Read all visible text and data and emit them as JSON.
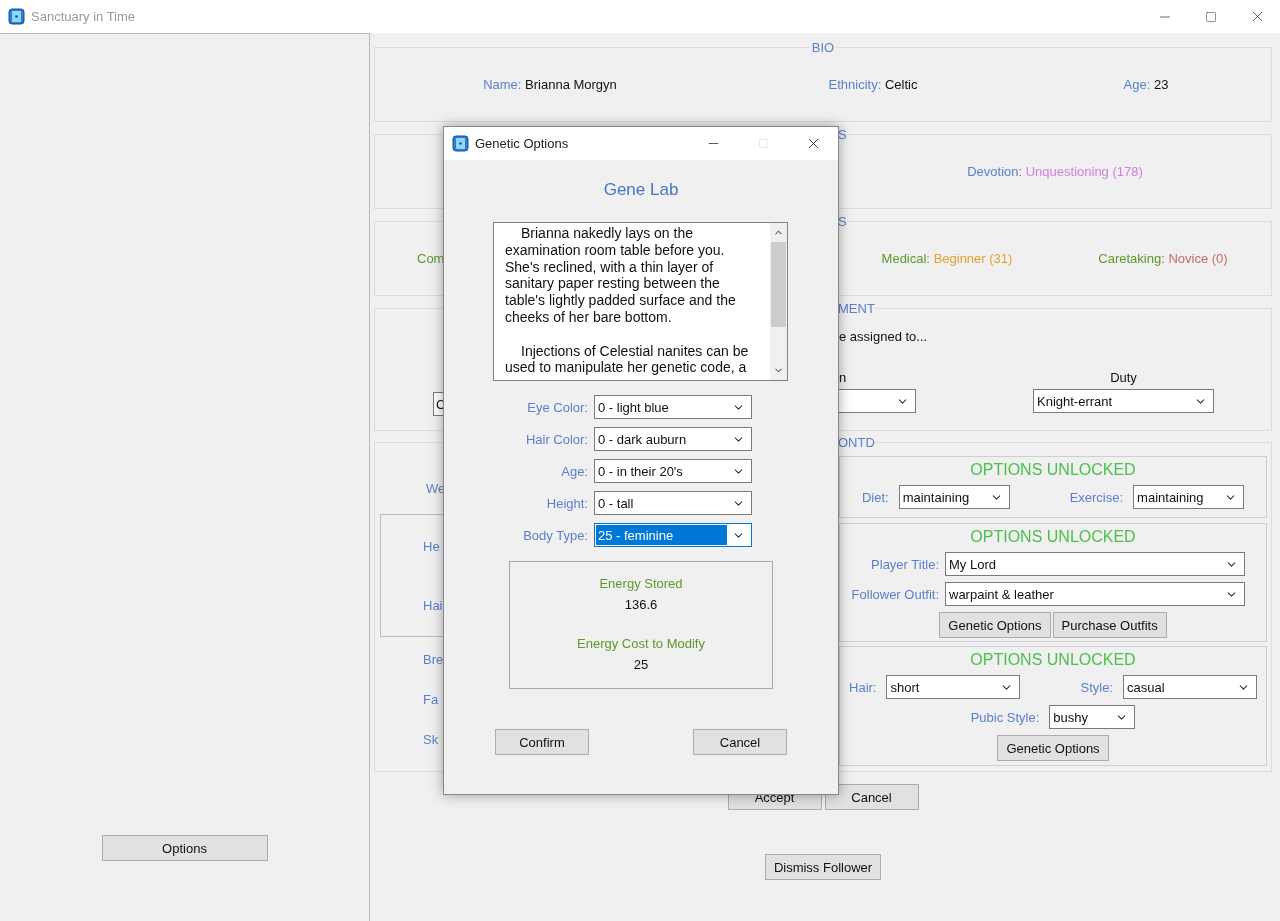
{
  "window": {
    "title": "Sanctuary in Time"
  },
  "sidebar": {
    "buttons": [
      "Options"
    ]
  },
  "bio": {
    "title": "BIO",
    "fields": [
      {
        "label": "Name:",
        "value": "Brianna Morgyn"
      },
      {
        "label": "Ethnicity:",
        "value": "Celtic"
      },
      {
        "label": "Age:",
        "value": "23"
      }
    ]
  },
  "section_2": {
    "title": "S",
    "fields": [
      {
        "label": "Devotion:",
        "value": "Unquestioning (178)",
        "color": "#d27fe0"
      }
    ]
  },
  "section_3": {
    "title": "S",
    "fragment": "Com",
    "fields": [
      {
        "label": "Medical:",
        "value": "Beginner (31)",
        "color": "#e6a030"
      },
      {
        "label": "Caretaking:",
        "value": "Novice (0)",
        "color": "#c86a6a"
      }
    ]
  },
  "assignment": {
    "title": "MENT",
    "prompt": "e assigned to...",
    "left_dropdown": "C",
    "columns": [
      {
        "label": "n"
      },
      {
        "label": "Duty",
        "value": "Knight-errant"
      }
    ]
  },
  "section_5": {
    "title": "ONTD",
    "fragments_top": [
      "We"
    ],
    "inner_fragments": [
      "He",
      "Hai"
    ],
    "fragments_bottom": [
      "Bre",
      "Fa",
      "Sk"
    ],
    "panels": [
      {
        "heading": "OPTIONS UNLOCKED",
        "kind": "inline",
        "rows": [
          [
            {
              "label": "Diet:",
              "value": "maintaining",
              "kind": "medium"
            },
            {
              "label": "Exercise:",
              "value": "maintaining",
              "kind": "medium"
            }
          ]
        ]
      },
      {
        "heading": "OPTIONS UNLOCKED",
        "kind": "form",
        "rows": [
          [
            {
              "label": "Player Title:",
              "value": "My Lord",
              "kind": "wide"
            }
          ],
          [
            {
              "label": "Follower Outfit:",
              "value": "warpaint & leather",
              "kind": "wide"
            }
          ]
        ],
        "buttons": [
          "Genetic Options",
          "Purchase Outfits"
        ]
      },
      {
        "heading": "OPTIONS UNLOCKED",
        "kind": "inline",
        "rows": [
          [
            {
              "label": "Hair:",
              "value": "short",
              "kind": "large"
            },
            {
              "label": "Style:",
              "value": "casual",
              "kind": "large"
            }
          ],
          [
            {
              "label": "Pubic Style:",
              "value": "bushy",
              "kind": "small"
            }
          ]
        ],
        "buttons": [
          "Genetic Options"
        ]
      }
    ]
  },
  "actions": [
    "Accept",
    "Cancel"
  ],
  "dismiss": "Dismiss Follower",
  "dialog": {
    "title": "Genetic Options",
    "heading": "Gene Lab",
    "description": [
      "Brianna nakedly lays on the examination room table before you. She's reclined, with a thin layer of sanitary paper resting between the table's lightly padded surface and the cheeks of her bare bottom.",
      "Injections of Celestial nanites can be used to manipulate her genetic code, a"
    ],
    "fields": [
      {
        "label": "Eye Color:",
        "value": "0 - light blue",
        "selected": false
      },
      {
        "label": "Hair Color:",
        "value": "0 - dark auburn",
        "selected": false
      },
      {
        "label": "Age:",
        "value": "0 - in their 20's",
        "selected": false
      },
      {
        "label": "Height:",
        "value": "0 - tall",
        "selected": false
      },
      {
        "label": "Body Type:",
        "value": "25 - feminine",
        "selected": true
      }
    ],
    "energy": [
      {
        "label": "Energy Stored",
        "value": "136.6"
      },
      {
        "label": "Energy Cost to Modify",
        "value": "25"
      }
    ],
    "buttons": [
      "Confirm",
      "Cancel"
    ]
  }
}
